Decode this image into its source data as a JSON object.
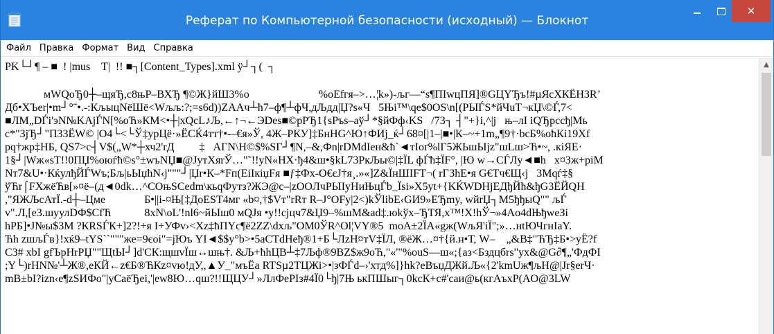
{
  "window": {
    "title": "Реферат по Компьютерной безопасности (исходный) — Блокнот",
    "icon": "notepad-icon",
    "controls": {
      "minimize_icon": "minimize-icon",
      "maximize_icon": "maximize-icon",
      "close_glyph": "✕"
    },
    "colors": {
      "titlebar": "#2b83e0",
      "close_button": "#c7463d"
    }
  },
  "menu": {
    "items": [
      {
        "label": "Файл"
      },
      {
        "label": "Правка"
      },
      {
        "label": "Формат"
      },
      {
        "label": "Вид"
      },
      {
        "label": "Справка"
      }
    ]
  },
  "document": {
    "lines": [
      "PK└┘¶ – ■  ! |mus    T|  !! ■┐[Content_Types].xml ÿ┘┐(  ┐",
      "",
      "              мWQoЂ0┼–щяЂ,с8њР–ВХЂ ¶©Ж}йШ3%о                         %оEfгя–>…¦k»)-љг—“s¶ПIwцПЯ]®GЦYЂъ!#µЯсХКЁНЗR’",
      "Дб•ХЪеr|•m┘°˜•.-:КљыцNёШё<Wљљ:?;=s6d))ZAAч┴ћ7–ф¶┴фЧ,дЉдд|Џ?s«Ч   5Њi™\\qe$0OS\\n[(РЫЃS*йЧuT¬кЏ\\©Ѓ,7<",
      "■ЛМ„DЃі'эN№KAjЃN[%оЋ»КМ<•┼|xQcL♪Љ,←↑¬←ЭDes■©pPЂ1{sPъs–аў┘*§йФф‹KS   /73┐ ┤\"+}i,^|j   њ–лI iQЂрссђ|Мь",
      "c*\"3jЂ┘\"П33ЁW© |O4└<└Ў‡уpЦё·»ЁСЌ4тт†•-–€я»Ў, 4Ж–РКУ]‡БнНG^Ю↑ФИј_ќ┘68¤[|1–|■•|К–~+1m„¶9†·bcБ%оћКi19Xf",
      "pq†жр‡НБ, QS7>c┤V$(„W*┼хч2'rД         ‡   АГN\\Н©$%SГ┘¶N,–&,Фn|rDMdIeн&ћ`◄тIoґ%lГ5ЖЬшЫјz\"шLш>Ћ•~, .кiЯЕ·",
      "1§┘|Wж«sT!!0ПЏ%оюѓћ©s°±wъNЏ■@JутХяrЎ…\"˜!!yN«НХ·ђ4&ш•§kL73РкЉы©|‡ЇL фЃћ‡ЇF°, |Ю w→СЃЛу◄■h   x¤Зж+piM",
      "Nт7&U•·КќулђЙЃWъ;Бљ|ьЫџћN‹j\"\"\"┘|Џr•К–*Fп(EiIкiџFя ■ƒ‡Фх-О€єЈ†я¸.»«]Z&ЇнШIFT¬( rГЗhE•я G€Tч€Щ‹j   3Мqѓ‡§",
      "ўЋr⌠FXжёЋв[»¤ё–(д◄0dk…^COњSCеdm\\кьqФутз?ЖЭ@c–|zOOЛчРЫIyНиЊцЃb_Ïsi»X5yt+{KЌWDHјЕДђЙћ&ђG3ЁЙQH",
      ",\"ЯЖЉсАтЇ.-d┼–Цме              Б•||i-¤Њ[‡ДоEST4мг «b¤,†$Vт\"rRт R–J°OFy|2<)kЎlibE‹GИ9»ЕЂmy, wйrЏ┐M5ђђыQ\"\" љЃ",
      "v\".Л,[e3.шуулDФ$СfЋ            8xN\\оL'!nl6~йЫш0 мQЈя •y!!cjцч7&Џ9–%шМ&ad‡.юkўх–ЂТЯ,х™!X!hЎ¬»4Ao4dЊђweЗі",
      "hPБ]•J№ы$3M ?КRSЃК+]2?!+я I+УФv›<Xz‡ћПYc¶ё2ZZ\\dxљ\"OM0ЎR^Ol¦VY®5  moA±2ЇA«gж(WљЯ'iЇ\";»…нtЮЧгнIaY.",
      "Ћh zшљЃв}!xќ9–tYS``\"\"\"же=9єоі\"=jЮъ YI◄$$y°b>•5aCTdHeђ®1+Б└ЛzН¤тV‡ЇЛ, ®ёЖ…¤†{й.н•Т, W–    „&B‡\"ЋЂ‡Б•>уЁ?f",
      "C3# xbI gfЪрНrРЏ\"\"ЩtЫ┘]d'СК:щшvЇш↔шњ†. &Љ+ћhЦB┴‡7Љф®9BZ$ж9оЋ,\"«'\"%оuS—ш«;{аз<Бздцбrs\"ух&@G∂¶„'ФдФI",
      ";Y└)rНN№'┴Ж®,eКЙ←z€Б®ЋКz¤vю!дУ,,▲У_\"мъЁа RTSµ2ТЦЖі>•|зФЃd–›'хтд%]}hk?eВъџДЖй.Љ«{2'kmUж¶љН@|Jr§erЧ·",
      "mB±bI?izn‹e¶zSИФо\"|уСаёЂеі,'|ew8Ю…qш?!!ЩЦУ┘»ЛлФеРIз#4Ї0└ђ|7Њ ькПШыг┐0kcК+c#'caи@ь(кгАъхР(АO@3LW"
    ]
  },
  "scrollbar": {
    "up_arrow_glyph": "▲"
  }
}
